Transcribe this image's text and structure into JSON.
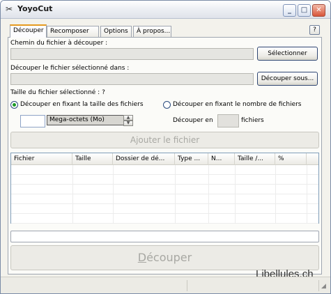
{
  "window": {
    "title": "YoyoCut",
    "icon": "scissors-icon"
  },
  "titlebar_buttons": {
    "minimize": "_",
    "maximize": "□",
    "close": "✕"
  },
  "tabs": [
    {
      "label": "Découper",
      "active": true
    },
    {
      "label": "Recomposer",
      "active": false
    },
    {
      "label": "Options",
      "active": false
    },
    {
      "label": "À propos...",
      "active": false
    }
  ],
  "help": {
    "label": "?"
  },
  "file_path": {
    "label": "Chemin du fichier à découper :",
    "value": "",
    "button": "Sélectionner"
  },
  "output_dir": {
    "label": "Découper le fichier sélectionné dans :",
    "value": "",
    "button": "Découper sous..."
  },
  "file_size": {
    "label": "Taille du fichier sélectionné : ?"
  },
  "mode": {
    "by_size": {
      "label": "Découper en fixant la taille des fichiers",
      "selected": true
    },
    "by_count": {
      "label": "Découper en fixant le nombre de fichiers",
      "selected": false
    }
  },
  "size_input": {
    "value": "",
    "unit": "Mega-octets (Mo)"
  },
  "count": {
    "prefix": "Découper en",
    "value": "",
    "suffix": "fichiers"
  },
  "add_button": {
    "label": "Ajouter le fichier"
  },
  "table": {
    "columns": [
      "Fichier",
      "Taille",
      "Dossier de dé...",
      "Type ...",
      "N...",
      "Taille /...",
      "%"
    ],
    "rows": []
  },
  "progress": 0,
  "cut_button": {
    "label": "Découper"
  },
  "watermark": "Libellules.ch"
}
